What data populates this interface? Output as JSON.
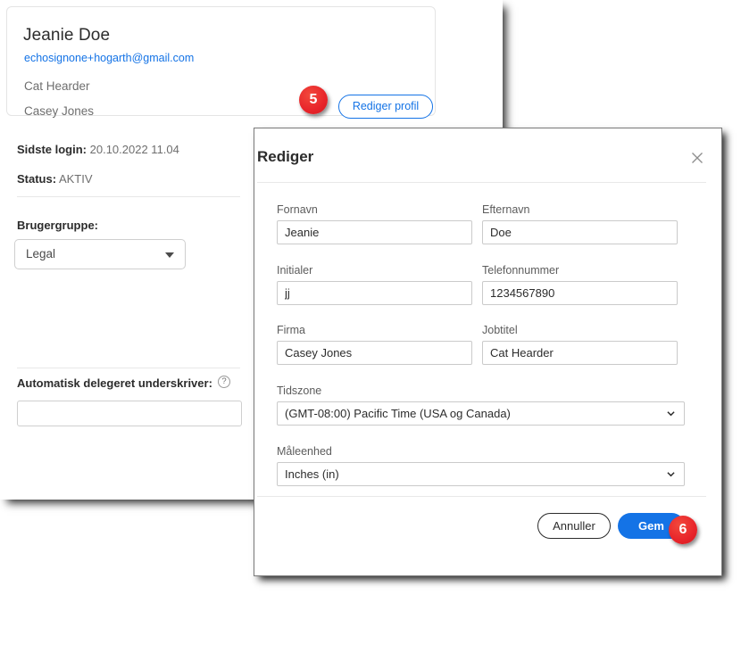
{
  "profile": {
    "name": "Jeanie Doe",
    "email": "echosignone+hogarth@gmail.com",
    "job_title": "Cat Hearder",
    "company": "Casey Jones",
    "edit_button_label": "Rediger profil",
    "last_login_label": "Sidste login:",
    "last_login_value": "20.10.2022 11.04",
    "status_label": "Status:",
    "status_value": "AKTIV",
    "usergroup_label": "Brugergruppe:",
    "usergroup_value": "Legal",
    "usergroup_caret_icon": "chevron-down-icon",
    "autodelegate_label": "Automatisk delegeret underskriver:",
    "autodelegate_help_icon": "question-mark-circle-icon",
    "autodelegate_help_glyph": "?",
    "autodelegate_value": "",
    "autodelegate_placeholder": ""
  },
  "dialog": {
    "title": "Rediger",
    "close_icon": "close-icon",
    "fields": {
      "firstname_label": "Fornavn",
      "firstname_value": "Jeanie",
      "lastname_label": "Efternavn",
      "lastname_value": "Doe",
      "initials_label": "Initialer",
      "initials_value": "jj",
      "phone_label": "Telefonnummer",
      "phone_value": "1234567890",
      "company_label": "Firma",
      "company_value": "Casey Jones",
      "jobtitle_label": "Jobtitel",
      "jobtitle_value": "Cat Hearder",
      "timezone_label": "Tidszone",
      "timezone_value": "(GMT-08:00) Pacific Time (USA og Canada)",
      "unit_label": "Måleenhed",
      "unit_value": "Inches (in)"
    },
    "cancel_label": "Annuller",
    "save_label": "Gem"
  },
  "callouts": {
    "step5": "5",
    "step6": "6"
  },
  "colors": {
    "accent_blue": "#1473e6",
    "callout_red": "#e8242a",
    "text_dark": "#2c2c2c",
    "text_muted": "#6e6e6e"
  }
}
